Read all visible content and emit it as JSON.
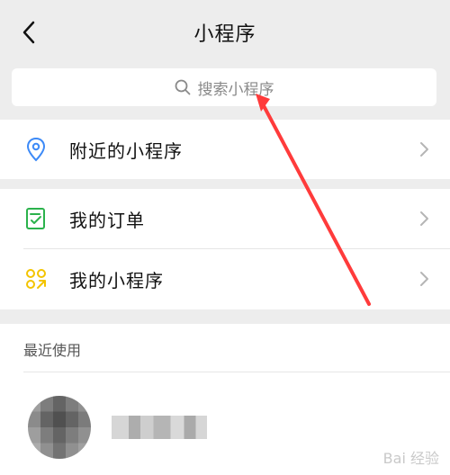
{
  "header": {
    "title": "小程序"
  },
  "search": {
    "placeholder": "搜索小程序"
  },
  "menu": {
    "nearby": "附近的小程序",
    "orders": "我的订单",
    "my_mini_programs": "我的小程序"
  },
  "recent": {
    "title": "最近使用"
  },
  "watermark": "Bai 经验",
  "colors": {
    "background": "#ededed",
    "accent_blue": "#3d8af7",
    "accent_green": "#2bb24c",
    "accent_yellow": "#f3c400",
    "arrow_red": "#ff3b3b"
  }
}
